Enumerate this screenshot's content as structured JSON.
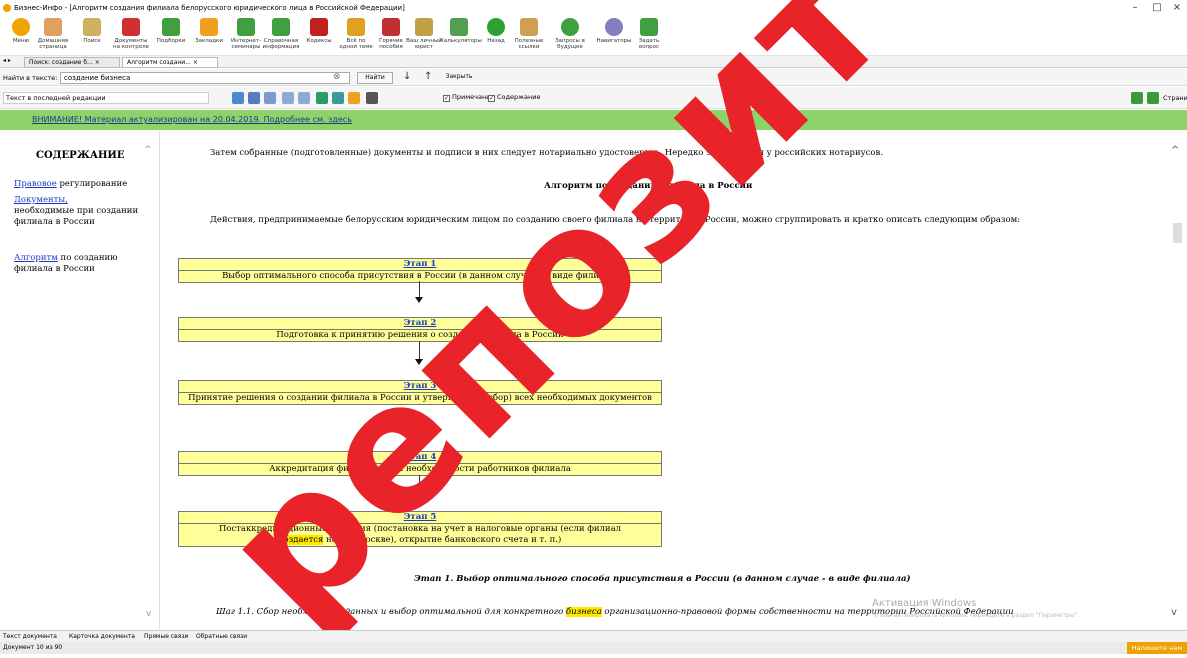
{
  "window": {
    "title": "Бизнес-Инфо - [Алгоритм создания филиала белорусского юридического лица в Российской Федерации]",
    "controls": [
      "–",
      "□",
      "×"
    ]
  },
  "toolbar": {
    "buttons": [
      {
        "label": "Меню",
        "icon": "menu-icon",
        "color": "#f0a400"
      },
      {
        "label": "Домашняя страница",
        "icon": "home-icon",
        "color": "#e0a060"
      },
      {
        "label": "Поиск",
        "icon": "search-icon",
        "color": "#d0b060"
      },
      {
        "label": "Документы на контроле",
        "icon": "documents-control-icon",
        "color": "#d03030"
      },
      {
        "label": "Подборки",
        "icon": "collections-icon",
        "color": "#40a040"
      },
      {
        "label": "Закладки",
        "icon": "bookmarks-icon",
        "color": "#f0a020"
      },
      {
        "label": "Интернет-семинары",
        "icon": "webinar-icon",
        "color": "#40a040"
      },
      {
        "label": "Справочная информация",
        "icon": "reference-icon",
        "color": "#40a040"
      },
      {
        "label": "Кодексы",
        "icon": "codes-icon",
        "color": "#c02020"
      },
      {
        "label": "Всё по одной теме",
        "icon": "topic-icon",
        "color": "#e0a020"
      },
      {
        "label": "Горячие пособия",
        "icon": "manuals-icon",
        "color": "#c03030"
      },
      {
        "label": "Ваш личный юрист",
        "icon": "lawyer-icon",
        "color": "#c0a040"
      },
      {
        "label": "Калькуляторы",
        "icon": "calculator-icon",
        "color": "#50a050"
      },
      {
        "label": "Назад",
        "icon": "back-icon",
        "color": "#30a030"
      },
      {
        "label": "Полезные ссылки",
        "icon": "links-icon",
        "color": "#d0a050"
      },
      {
        "label": "Запросы в будущее",
        "icon": "future-requests-icon",
        "color": "#40a040"
      },
      {
        "label": "Навигаторы",
        "icon": "navigator-icon",
        "color": "#8080c0"
      },
      {
        "label": "Задать вопрос",
        "icon": "question-icon",
        "color": "#40a040"
      }
    ]
  },
  "tabs": [
    {
      "label": "Поиск: создание б...",
      "close": "×"
    },
    {
      "label": "Алгоритм создани...",
      "close": "×"
    }
  ],
  "findbar": {
    "label": "Найти в тексте:",
    "value": "создание бизнеса",
    "clear": "⊗",
    "find_button": "Найти",
    "close_button": "Закрыть"
  },
  "edition": {
    "value": "Текст в последней редакции",
    "notes_label": "Примечания",
    "content_label": "Содержание",
    "page_label": "Страница"
  },
  "warning": {
    "text": "ВНИМАНИЕ! Материал актуализирован на 20.04.2019. Подробнее см. здесь"
  },
  "sidebar": {
    "heading": "СОДЕРЖАНИЕ",
    "items": [
      {
        "link": "Правовое",
        "rest": " регулирование"
      },
      {
        "link": "Документы,",
        "rest": "необходимые при создании филиала в России"
      },
      {
        "link": "Алгоритм",
        "rest": " по созданию филиала в России"
      }
    ]
  },
  "content": {
    "intro": "Затем собранные (подготовленные) документы и подписи в них следует нотариально удостоверить. Нередко это делается у российских нотариусов.",
    "heading": "Алгоритм по созданию филиала в России",
    "lead": "Действия, предпринимаемые белорусским юридическим лицом по созданию своего филиала на территории России, можно сгруппировать и кратко описать следующим образом:",
    "stages": [
      {
        "title": "Этап 1",
        "desc": "Выбор оптимального способа присутствия в России (в данном случае - в виде филиала)"
      },
      {
        "title": "Этап 2",
        "desc": "Подготовка к принятию решения о создании филиала в России"
      },
      {
        "title": "Этап 3",
        "desc": "Принятие решения о создании филиала в России и утверждение (сбор) всех необходимых документов"
      },
      {
        "title": "Этап 4",
        "desc": "Аккредитация филиала и при необходимости работников филиала"
      },
      {
        "title": "Этап 5",
        "desc_a": "Постаккредитационные действия (постановка на учет в налоговые органы (если филиал",
        "desc_hl": "создается",
        "desc_b": " не в г. Москве), открытие банковского счета и т. п.)"
      }
    ],
    "stage1_heading": "Этап 1. Выбор оптимального способа присутствия в России (в данном случае - в виде филиала)",
    "step_a": "Шаг 1.1. Сбор необходимых данных и выбор оптимальной для конкретного ",
    "step_hl": "бизнеса",
    "step_b": " организационно-правовой формы собственности на территории Российской Федерации"
  },
  "activation": {
    "title": "Активация Windows",
    "text": "Чтобы активировать Windows, перейдите в раздел \"Параметры\"."
  },
  "watermark": "репозит",
  "bottom_tabs": [
    "Текст документа",
    "Карточка документа",
    "Прямые связи",
    "Обратные связи"
  ],
  "status": "Документ 10 из 90",
  "write_us": "Напишите нам"
}
